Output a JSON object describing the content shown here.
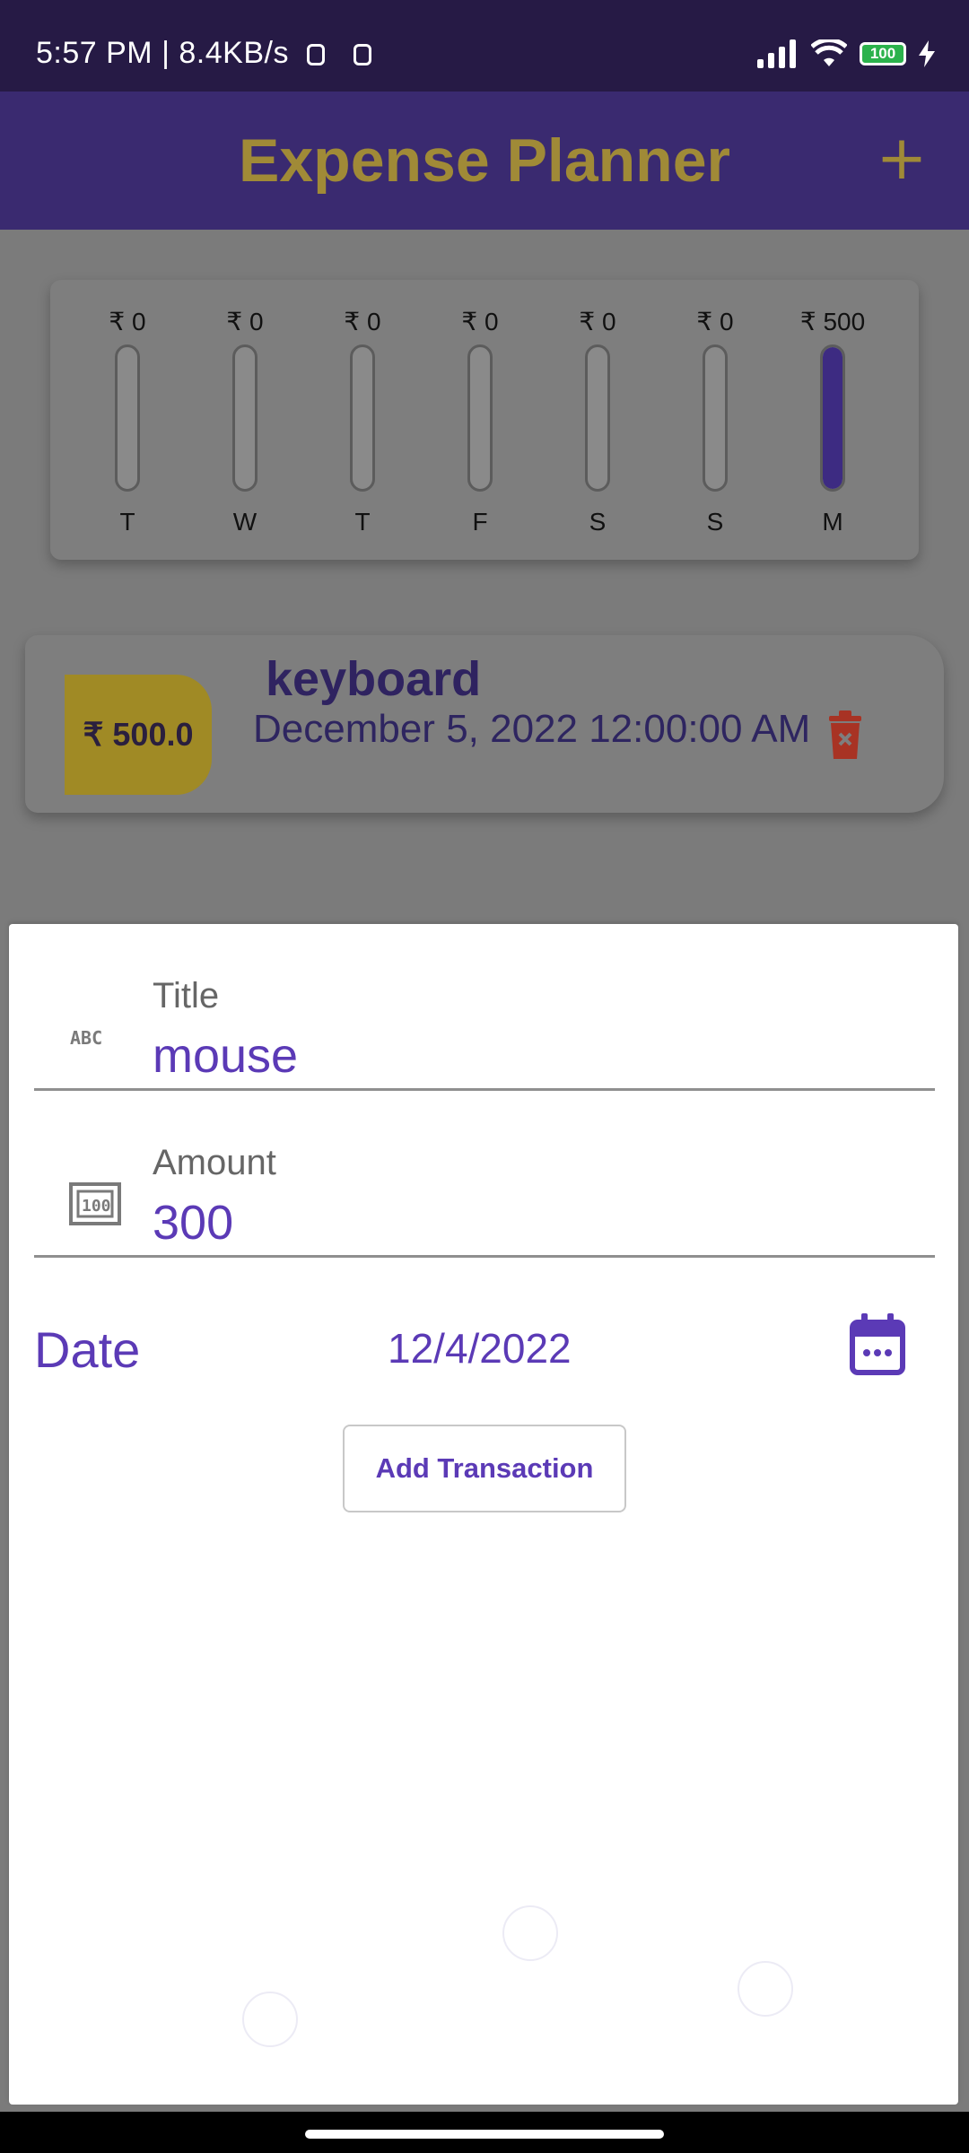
{
  "status_bar": {
    "time": "5:57 PM",
    "separator": "|",
    "speed": "8.4KB/s",
    "battery": "100"
  },
  "app_bar": {
    "title": "Expense Planner",
    "add_symbol": "+"
  },
  "chart": {
    "bars": [
      {
        "amount": "₹ 0",
        "day": "T",
        "fraction": 0
      },
      {
        "amount": "₹ 0",
        "day": "W",
        "fraction": 0
      },
      {
        "amount": "₹ 0",
        "day": "T",
        "fraction": 0
      },
      {
        "amount": "₹ 0",
        "day": "F",
        "fraction": 0
      },
      {
        "amount": "₹ 0",
        "day": "S",
        "fraction": 0
      },
      {
        "amount": "₹ 0",
        "day": "S",
        "fraction": 0
      },
      {
        "amount": "₹ 500",
        "day": "M",
        "fraction": 1
      }
    ]
  },
  "transactions": [
    {
      "amount": "₹ 500.0",
      "title": "keyboard",
      "date": "December 5, 2022 12:00:00 AM"
    }
  ],
  "form": {
    "title_label": "Title",
    "title_value": "mouse",
    "amount_label": "Amount",
    "amount_value": "300",
    "date_label": "Date",
    "date_value": "12/4/2022",
    "submit_label": "Add Transaction"
  },
  "colors": {
    "primary": "#3a2a70",
    "accent": "#a08a37",
    "input_text": "#5b3ab6",
    "delete": "#c0392b"
  },
  "icons": [
    "abc-icon",
    "money-100-icon",
    "calendar-icon",
    "delete-icon",
    "plus-icon",
    "wifi-icon",
    "signal-icon"
  ]
}
